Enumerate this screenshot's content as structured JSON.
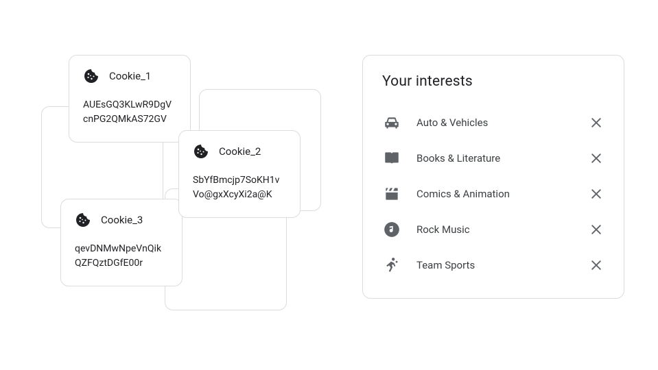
{
  "cookies": [
    {
      "name": "Cookie_1",
      "line1": "AUEsGQ3KLwR9DgV",
      "line2": "cnPG2QMkAS72GV"
    },
    {
      "name": "Cookie_2",
      "line1": "SbYfBmcjp7SoKH1v",
      "line2": "Vo@gxXcyXi2a@K"
    },
    {
      "name": "Cookie_3",
      "line1": "qevDNMwNpeVnQik",
      "line2": "QZFQztDGfE00r"
    }
  ],
  "interests": {
    "title": "Your interests",
    "items": [
      {
        "label": "Auto & Vehicles",
        "icon": "car-icon"
      },
      {
        "label": "Books & Literature",
        "icon": "book-icon"
      },
      {
        "label": "Comics & Animation",
        "icon": "clapper-icon"
      },
      {
        "label": "Rock Music",
        "icon": "music-icon"
      },
      {
        "label": "Team Sports",
        "icon": "sports-icon"
      }
    ]
  }
}
